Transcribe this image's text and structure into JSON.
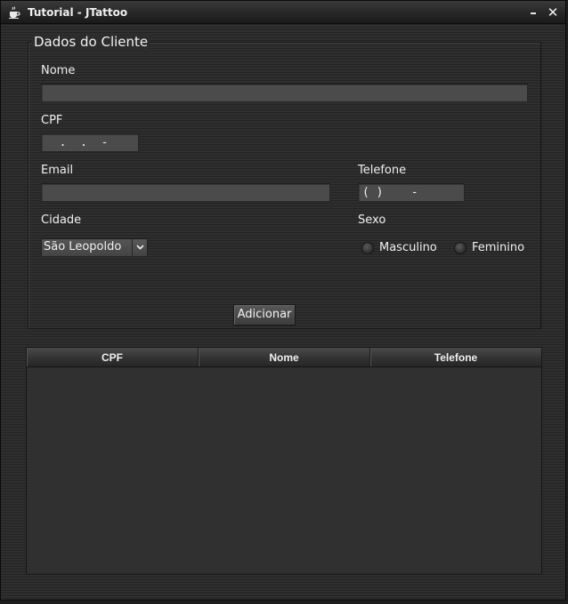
{
  "window": {
    "title": "Tutorial - JTattoo",
    "minimize_glyph": "–",
    "close_glyph": "✕",
    "icon": "java-cup-icon"
  },
  "form": {
    "group_title": "Dados do Cliente",
    "nome_label": "Nome",
    "nome_value": "",
    "cpf_label": "CPF",
    "cpf_value": "  .  .  -",
    "email_label": "Email",
    "email_value": "",
    "telefone_label": "Telefone",
    "telefone_value": "( )    -",
    "cidade_label": "Cidade",
    "cidade_value": "São Leopoldo",
    "sexo_label": "Sexo",
    "sexo_options": [
      "Masculino",
      "Feminino"
    ],
    "add_button_label": "Adicionar"
  },
  "table": {
    "columns": [
      "CPF",
      "Nome",
      "Telefone"
    ],
    "rows": []
  }
}
